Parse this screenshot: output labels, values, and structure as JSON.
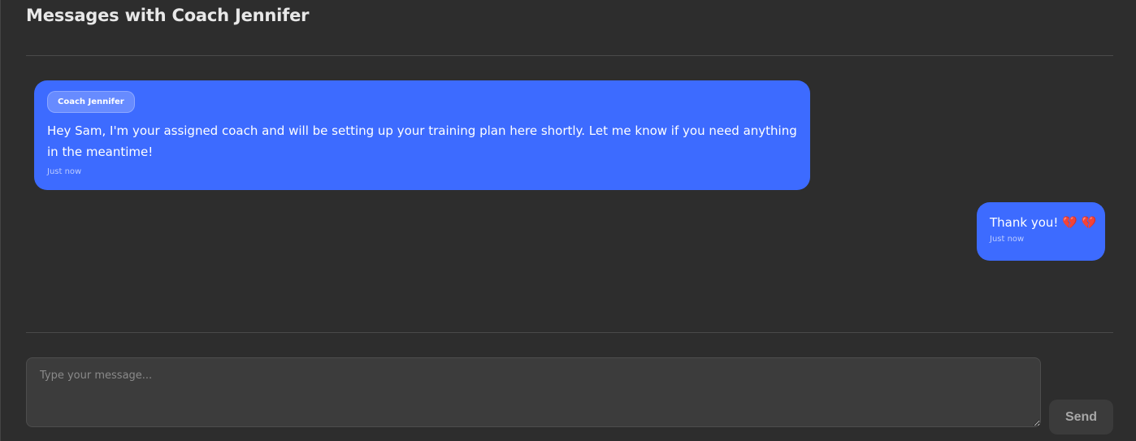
{
  "header": {
    "title": "Messages with Coach Jennifer"
  },
  "messages": [
    {
      "sender": "Coach Jennifer",
      "text": "Hey Sam, I'm your assigned coach and will be setting up your training plan here shortly. Let me know if you need anything in the meantime!",
      "time": "Just now"
    },
    {
      "text": "Thank you!",
      "emoji": "💔 💔",
      "time": "Just now"
    }
  ],
  "composer": {
    "placeholder": "Type your message...",
    "value": "",
    "send_label": "Send"
  },
  "colors": {
    "background": "#2d2d2d",
    "bubble": "#3d6bff",
    "heart": "#e0357a"
  }
}
